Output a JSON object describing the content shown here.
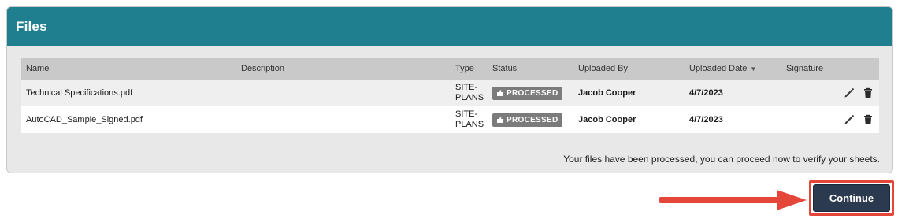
{
  "panel": {
    "title": "Files"
  },
  "table": {
    "headers": {
      "name": "Name",
      "description": "Description",
      "type": "Type",
      "status": "Status",
      "uploaded_by": "Uploaded By",
      "uploaded_date": "Uploaded Date",
      "signature": "Signature"
    },
    "rows": [
      {
        "name": "Technical Specifications.pdf",
        "description": "",
        "type_line1": "SITE-",
        "type_line2": "PLANS",
        "status": "PROCESSED",
        "uploaded_by": "Jacob Cooper",
        "uploaded_date": "4/7/2023"
      },
      {
        "name": "AutoCAD_Sample_Signed.pdf",
        "description": "",
        "type_line1": "SITE-",
        "type_line2": "PLANS",
        "status": "PROCESSED",
        "uploaded_by": "Jacob Cooper",
        "uploaded_date": "4/7/2023"
      }
    ]
  },
  "message": "Your files have been processed, you can proceed now to verify your sheets.",
  "continue_label": "Continue",
  "icons": {
    "status": "thumbs-up-icon",
    "edit": "pencil-icon",
    "delete": "trash-icon",
    "sort": "sort-desc-icon",
    "callout": "arrow-right-icon"
  },
  "colors": {
    "header": "#1f7f8f",
    "badge": "#7b7b7b",
    "button": "#2c3a4f",
    "callout": "#e4463a"
  }
}
